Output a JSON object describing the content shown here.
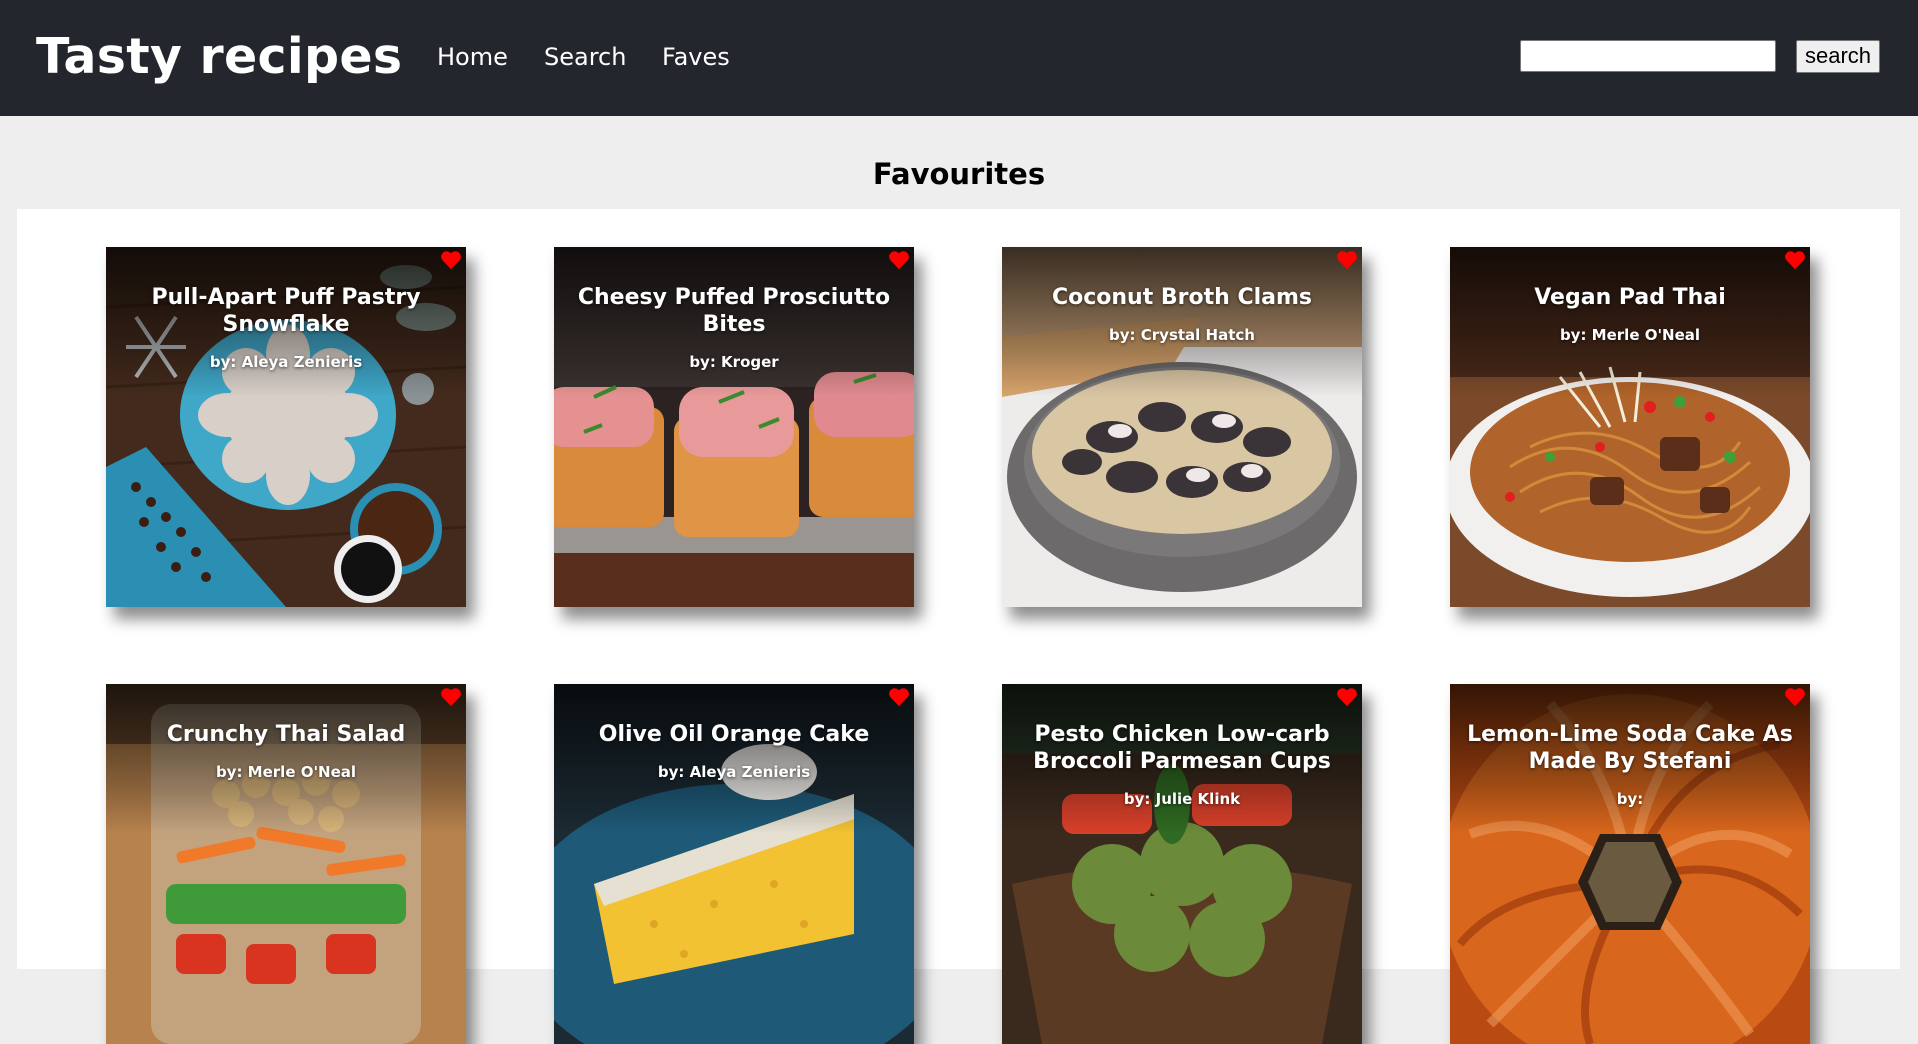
{
  "header": {
    "brand": "Tasty recipes",
    "nav": [
      "Home",
      "Search",
      "Faves"
    ],
    "search_value": "",
    "search_button": "search"
  },
  "page": {
    "title": "Favourites"
  },
  "colors": {
    "topbar": "#23262d",
    "heart": "#ff0000",
    "background": "#eeeeee"
  },
  "recipes": [
    {
      "title": "Pull-Apart Puff Pastry Snowflake",
      "author": "by: Aleya Zenieris",
      "favourite": true,
      "image": "snowflake-pastry"
    },
    {
      "title": "Cheesy Puffed Prosciutto Bites",
      "author": "by: Kroger",
      "favourite": true,
      "image": "prosciutto-bites"
    },
    {
      "title": "Coconut Broth Clams",
      "author": "by: Crystal Hatch",
      "favourite": true,
      "image": "clams-bowl"
    },
    {
      "title": "Vegan Pad Thai",
      "author": "by: Merle O'Neal",
      "favourite": true,
      "image": "pad-thai"
    },
    {
      "title": "Crunchy Thai Salad",
      "author": "by: Merle O'Neal",
      "favourite": true,
      "image": "salad-jar"
    },
    {
      "title": "Olive Oil Orange Cake",
      "author": "by: Aleya Zenieris",
      "favourite": true,
      "image": "orange-cake"
    },
    {
      "title": "Pesto Chicken Low-carb Broccoli Parmesan Cups",
      "author": "by: Julie Klink",
      "favourite": true,
      "image": "pesto-cups"
    },
    {
      "title": "Lemon-Lime Soda Cake As Made By Stefani",
      "author": "by:",
      "favourite": true,
      "image": "bundt-cake"
    }
  ]
}
